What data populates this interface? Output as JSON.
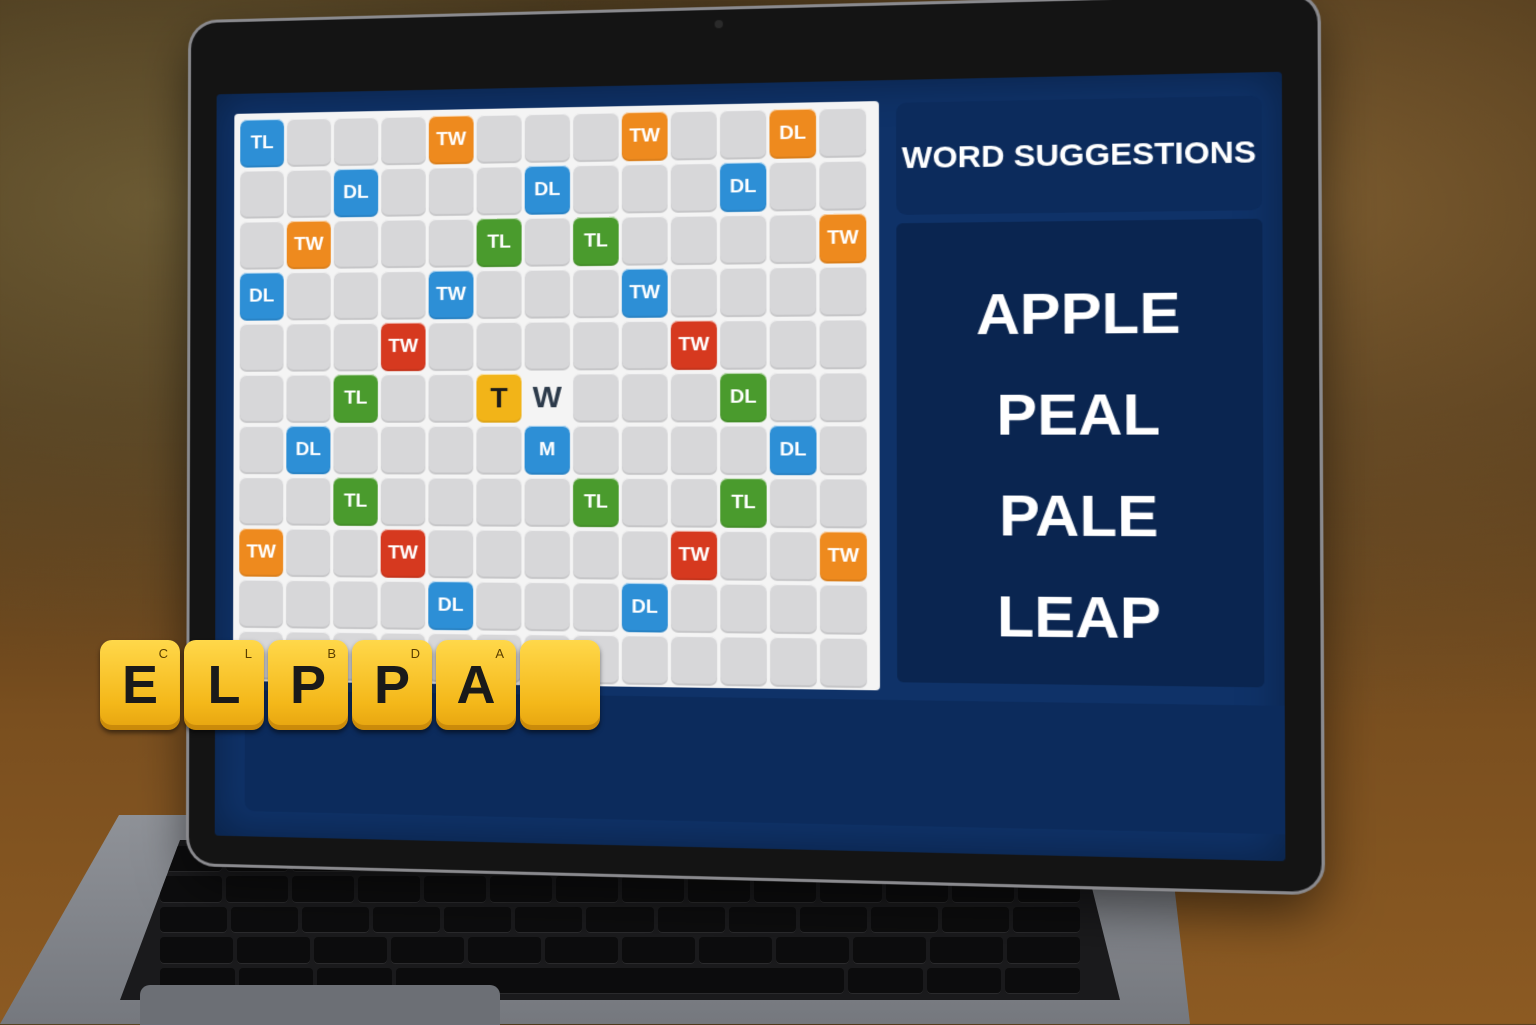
{
  "board": {
    "rows": [
      [
        "TL",
        "",
        "",
        "",
        "TW",
        "",
        "",
        "",
        "TW",
        "",
        "",
        "DL",
        ""
      ],
      [
        "",
        "",
        "DL",
        "",
        "",
        "",
        "DL",
        "",
        "",
        "",
        "DL",
        "",
        ""
      ],
      [
        "",
        "TW",
        "",
        "",
        "",
        "TL",
        "",
        "TL",
        "",
        "",
        "",
        "",
        "TW"
      ],
      [
        "DL",
        "",
        "",
        "",
        "TW",
        "",
        "",
        "",
        "TW",
        "",
        "",
        "",
        ""
      ],
      [
        "",
        "",
        "",
        "TW",
        "",
        "",
        "",
        "",
        "",
        "TW",
        "",
        "",
        ""
      ],
      [
        "",
        "",
        "TL",
        "",
        "",
        "T",
        "W",
        "",
        "",
        "",
        "DL",
        "",
        ""
      ],
      [
        "",
        "DL",
        "",
        "",
        "",
        "",
        "M",
        "",
        "",
        "",
        "",
        "DL",
        ""
      ],
      [
        "",
        "",
        "TL",
        "",
        "",
        "",
        "",
        "TL",
        "",
        "",
        "TL",
        "",
        ""
      ],
      [
        "TW",
        "",
        "",
        "TW",
        "",
        "",
        "",
        "",
        "",
        "TW",
        "",
        "",
        "TW"
      ],
      [
        "",
        "",
        "",
        "",
        "DL",
        "",
        "",
        "",
        "DL",
        "",
        "",
        "",
        ""
      ],
      [
        "",
        "",
        "",
        "",
        "",
        "",
        "",
        "",
        "",
        "",
        "",
        "",
        ""
      ]
    ]
  },
  "rack": {
    "tiles": [
      {
        "letter": "E",
        "sub": "C"
      },
      {
        "letter": "L",
        "sub": "L"
      },
      {
        "letter": "P",
        "sub": "B"
      },
      {
        "letter": "P",
        "sub": "D"
      },
      {
        "letter": "A",
        "sub": "A"
      },
      {
        "letter": "",
        "sub": ""
      }
    ]
  },
  "suggestions": {
    "title": "WORD SUGGESTIONS",
    "words": [
      "APPLE",
      "PEAL",
      "PALE",
      "LEAP"
    ]
  }
}
